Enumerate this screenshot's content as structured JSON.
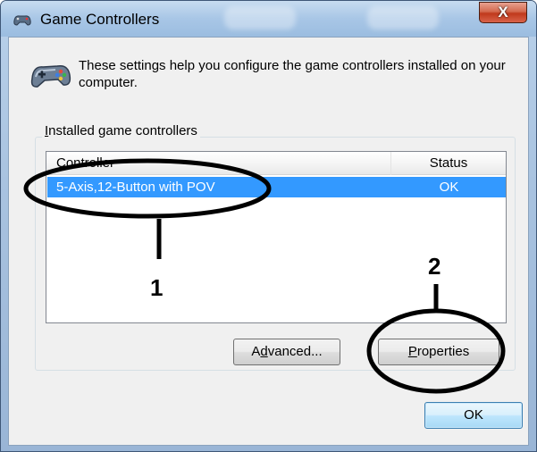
{
  "window": {
    "title": "Game Controllers",
    "close_label": "X"
  },
  "intro": {
    "text": "These settings help you configure the game controllers installed on your computer."
  },
  "group": {
    "label_prefix_underlined": "I",
    "label_rest": "nstalled game controllers"
  },
  "list": {
    "columns": [
      "Controller",
      "Status"
    ],
    "rows": [
      {
        "controller": "5-Axis,12-Button with POV",
        "status": "OK",
        "selected": true
      }
    ]
  },
  "buttons": {
    "advanced_pre": "A",
    "advanced_underlined": "d",
    "advanced_post": "vanced...",
    "properties_underlined": "P",
    "properties_post": "roperties",
    "ok": "OK"
  },
  "annotations": {
    "callout_1": "1",
    "callout_2": "2"
  },
  "colors": {
    "selection": "#3399ff",
    "callout_ink": "#000000"
  },
  "icons": {
    "title_icon": "gamepad-small-icon",
    "main_icon": "gamepad-icon"
  }
}
